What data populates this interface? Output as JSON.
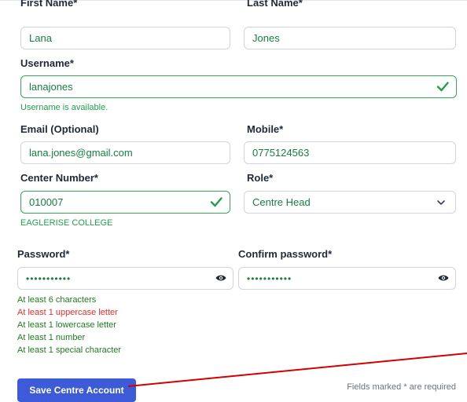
{
  "form": {
    "first_name": {
      "label": "First Name*",
      "value": "Lana"
    },
    "last_name": {
      "label": "Last Name*",
      "value": "Jones"
    },
    "username": {
      "label": "Username*",
      "value": "lanajones",
      "status": "Username is available."
    },
    "email": {
      "label": "Email (Optional)",
      "value": "lana.jones@gmail.com"
    },
    "mobile": {
      "label": "Mobile*",
      "value": "0775124563"
    },
    "center_number": {
      "label": "Center Number*",
      "value": "010007",
      "status": "EAGLERISE COLLEGE"
    },
    "role": {
      "label": "Role*",
      "value": "Centre Head"
    },
    "password": {
      "label": "Password*",
      "value": "•••••••••••"
    },
    "confirm_password": {
      "label": "Confirm password*",
      "value": "•••••••••••"
    },
    "password_rules": [
      {
        "text": "At least 6 characters",
        "met": true
      },
      {
        "text": "At least 1 uppercase letter",
        "met": false
      },
      {
        "text": "At least 1 lowercase letter",
        "met": true
      },
      {
        "text": "At least 1 number",
        "met": true
      },
      {
        "text": "At least 1 special character",
        "met": true
      }
    ],
    "save_label": "Save Centre Account",
    "required_note": "Fields marked * are required"
  },
  "colors": {
    "valid": "#34a853",
    "met": "#1e7d1e",
    "unmet": "#ef2a2a",
    "primary": "#3d5bd9",
    "annotation": "#d40000"
  },
  "icons": {
    "valid": "check-icon",
    "dropdown": "chevron-down-icon",
    "reveal": "eye-icon"
  }
}
